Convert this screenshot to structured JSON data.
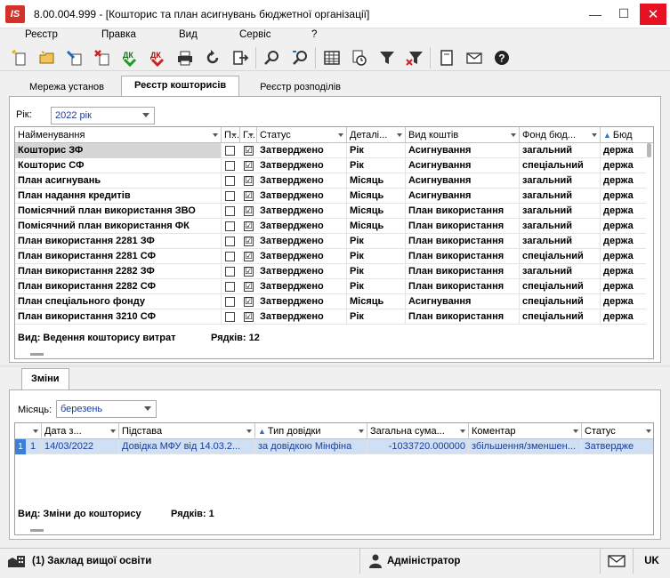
{
  "window": {
    "title": "8.00.004.999 - [Кошторис та план асигнувань бюджетної організації]",
    "logo_text": "IS",
    "minimize": "—",
    "maximize": "☐",
    "close": "✕"
  },
  "menu": [
    "Реєстр",
    "Правка",
    "Вид",
    "Сервіс",
    "?"
  ],
  "toolbar_icons": [
    "new-icon",
    "open-folder-icon",
    "edit-icon",
    "delete-icon",
    "approve-dk-icon",
    "reject-dk-icon",
    "print-icon",
    "refresh-icon",
    "export-icon",
    "search-icon",
    "find-next-icon",
    "table-icon",
    "clock-settings-icon",
    "filter-icon",
    "clear-filter-icon",
    "document-icon",
    "mail-icon",
    "help-icon"
  ],
  "tabs": [
    "Мережа установ",
    "Реєстр кошторисів",
    "Реєстр розподілів"
  ],
  "active_tab": 1,
  "year_filter": {
    "label": "Рік:",
    "value": "2022 рік"
  },
  "main_grid": {
    "columns": [
      "Найменування",
      "П...",
      "Г...",
      "Статус",
      "Деталі...",
      "Вид коштів",
      "Фонд бюд...",
      "Бюд"
    ],
    "rows": [
      [
        "Кошторис ЗФ",
        "",
        "☑",
        "Затверджено",
        "Рік",
        "Асигнування",
        "загальний",
        "держа"
      ],
      [
        "Кошторис СФ",
        "",
        "☑",
        "Затверджено",
        "Рік",
        "Асигнування",
        "спеціальний",
        "держа"
      ],
      [
        "План асигнувань",
        "",
        "☑",
        "Затверджено",
        "Місяць",
        "Асигнування",
        "загальний",
        "держа"
      ],
      [
        "План надання кредитів",
        "",
        "☑",
        "Затверджено",
        "Місяць",
        "Асигнування",
        "загальний",
        "держа"
      ],
      [
        "Помісячний план використання ЗВО",
        "",
        "☑",
        "Затверджено",
        "Місяць",
        "План використання",
        "загальний",
        "держа"
      ],
      [
        "Помісячний план використання ФК",
        "",
        "☑",
        "Затверджено",
        "Місяць",
        "План використання",
        "загальний",
        "держа"
      ],
      [
        "План використання 2281 ЗФ",
        "",
        "☑",
        "Затверджено",
        "Рік",
        "План використання",
        "загальний",
        "держа"
      ],
      [
        "План використання 2281 СФ",
        "",
        "☑",
        "Затверджено",
        "Рік",
        "План використання",
        "спеціальний",
        "держа"
      ],
      [
        "План використання 2282 ЗФ",
        "",
        "☑",
        "Затверджено",
        "Рік",
        "План використання",
        "загальний",
        "держа"
      ],
      [
        "План використання 2282 СФ",
        "",
        "☑",
        "Затверджено",
        "Рік",
        "План використання",
        "спеціальний",
        "держа"
      ],
      [
        "План спеціального фонду",
        "",
        "☑",
        "Затверджено",
        "Місяць",
        "Асигнування",
        "спеціальний",
        "держа"
      ],
      [
        "План використання 3210 СФ",
        "",
        "☑",
        "Затверджено",
        "Рік",
        "План використання",
        "спеціальний",
        "держа"
      ]
    ],
    "summary_view": "Вид: Ведення кошторису витрат",
    "summary_rows": "Рядків: 12"
  },
  "bottom_tab": "Зміни",
  "month_filter": {
    "label": "Місяць:",
    "value": "березень"
  },
  "changes_grid": {
    "columns": [
      "",
      "Дата з...",
      "Підстава",
      "Тип довідки",
      "Загальна сума...",
      "Коментар",
      "Статус"
    ],
    "rows": [
      [
        "1",
        "14/03/2022",
        "Довідка МФУ від 14.03.2...",
        "за довідкою Мінфіна",
        "-1033720.000000",
        "збільшення/зменшен...",
        "Затвердже"
      ]
    ],
    "row_marker": "1",
    "summary_view": "Вид: Зміни до кошторису",
    "summary_rows": "Рядків: 1"
  },
  "statusbar": {
    "org": "(1) Заклад вищої освіти",
    "user": "Адміністратор",
    "lang": "UK"
  }
}
